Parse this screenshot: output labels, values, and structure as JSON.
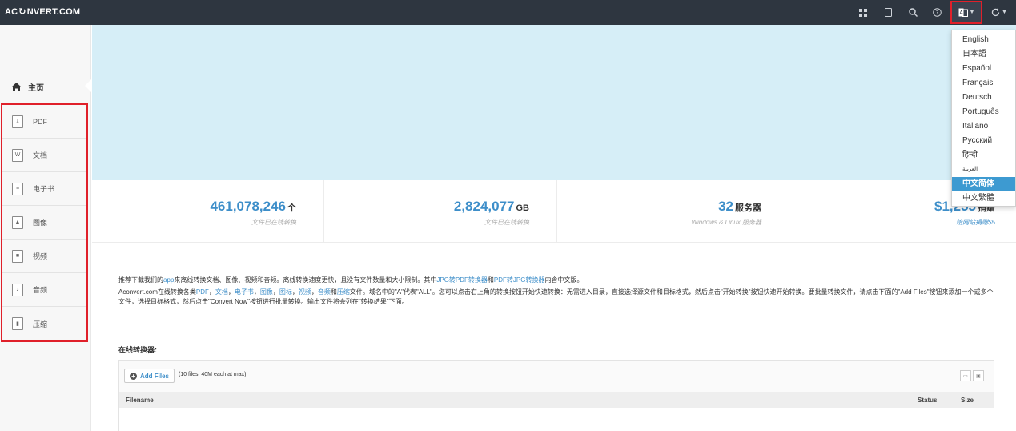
{
  "header": {
    "logo_text_left": "AC",
    "logo_text_right": "NVERT.COM",
    "icons": [
      "apps-icon",
      "tablet-icon",
      "search-icon",
      "help-icon",
      "language-icon",
      "refresh-icon"
    ]
  },
  "sidebar": {
    "home_label": "主页",
    "items": [
      {
        "label": "PDF",
        "icon": "pdf-file-icon"
      },
      {
        "label": "文档",
        "icon": "word-file-icon"
      },
      {
        "label": "电子书",
        "icon": "ebook-file-icon"
      },
      {
        "label": "图像",
        "icon": "image-file-icon"
      },
      {
        "label": "视频",
        "icon": "video-file-icon"
      },
      {
        "label": "音频",
        "icon": "audio-file-icon"
      },
      {
        "label": "压缩",
        "icon": "archive-file-icon"
      }
    ]
  },
  "stats": [
    {
      "value": "461,078,246",
      "unit": "个",
      "caption": "文件已在线转换"
    },
    {
      "value": "2,824,077",
      "unit": "GB",
      "caption": "文件已在线转换"
    },
    {
      "value": "32",
      "unit": "服务器",
      "caption": "Windows & Linux 服务器"
    },
    {
      "value": "$1,255",
      "unit": "捐赠",
      "caption": "给网站捐赠$5"
    }
  ],
  "description": {
    "p1_a": "推荐下载我们的",
    "p1_app": "app",
    "p1_b": "来离线转换文档、图像、视频和音频。离线转换速度更快，且没有文件数量和大小限制。其中",
    "p1_link1": "JPG转PDF转换器",
    "p1_c": "和",
    "p1_link2": "PDF转JPG转换器",
    "p1_d": "内含中文版。",
    "p2_a": "Aconvert.com在线转换各类",
    "p2_l1": "PDF",
    "p2_s1": "，",
    "p2_l2": "文档",
    "p2_s2": "，",
    "p2_l3": "电子书",
    "p2_s3": "，",
    "p2_l4": "图像",
    "p2_s4": "，",
    "p2_l5": "图标",
    "p2_s5": "，",
    "p2_l6": "视频",
    "p2_s6": "，",
    "p2_l7": "音频",
    "p2_s7": "和",
    "p2_l8": "压缩",
    "p2_b": "文件。域名中的\"A\"代表\"ALL\"。您可以点击右上角的转换按钮开始快速转换：无需进入目录，直接选择源文件和目标格式，然后点击\"开始转换\"按钮快速开始转换。要批量转换文件，请点击下面的\"Add Files\"按钮来添加一个或多个文件，选择目标格式，然后点击\"Convert Now\"按钮进行批量转换。输出文件将会列在\"转换结果\"下面。"
  },
  "converter": {
    "title": "在线转换器:",
    "add_files_label": "Add Files",
    "add_files_note": "(10 files, 40M each at max)",
    "columns": [
      "Filename",
      "Status",
      "Size"
    ]
  },
  "language_menu": {
    "items": [
      "English",
      "日本語",
      "Español",
      "Français",
      "Deutsch",
      "Português",
      "Italiano",
      "Русский",
      "हिन्दी",
      "العربية",
      "中文简体",
      "中文繁體"
    ],
    "selected": "中文简体"
  },
  "colors": {
    "topbar": "#2e3640",
    "accent": "#3d8ec9",
    "banner": "#d6eef7",
    "highlight_border": "#e0202a",
    "menu_active": "#3d9ad1"
  }
}
